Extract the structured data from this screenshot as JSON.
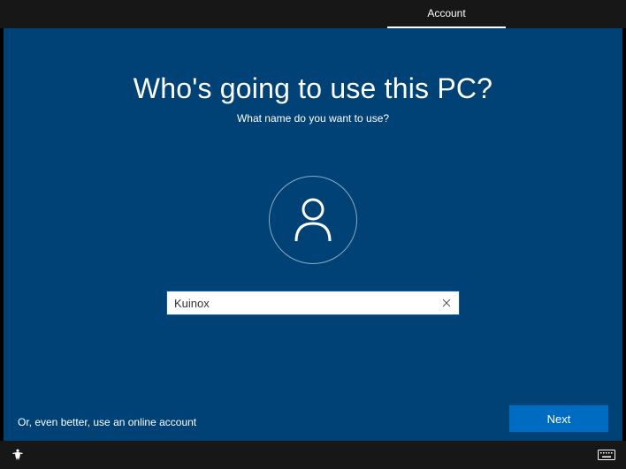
{
  "topbar": {
    "active_tab": "Account"
  },
  "main": {
    "heading": "Who's going to use this PC?",
    "subheading": "What name do you want to use?",
    "username_value": "Kuinox",
    "online_account_link": "Or, even better, use an online account",
    "next_button": "Next"
  }
}
